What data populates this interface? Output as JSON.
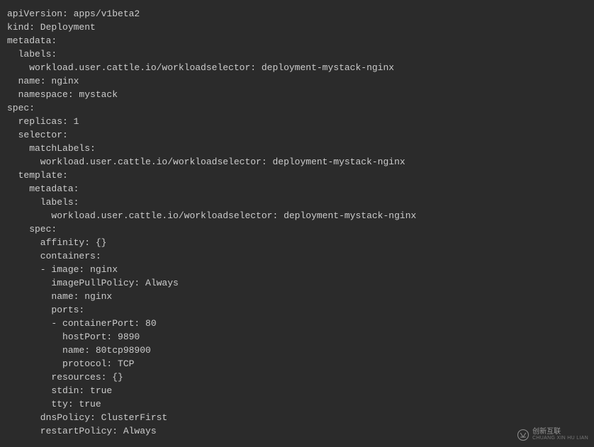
{
  "yaml": {
    "lines": [
      "apiVersion: apps/v1beta2",
      "kind: Deployment",
      "metadata:",
      "  labels:",
      "    workload.user.cattle.io/workloadselector: deployment-mystack-nginx",
      "  name: nginx",
      "  namespace: mystack",
      "spec:",
      "  replicas: 1",
      "  selector:",
      "    matchLabels:",
      "      workload.user.cattle.io/workloadselector: deployment-mystack-nginx",
      "  template:",
      "    metadata:",
      "      labels:",
      "        workload.user.cattle.io/workloadselector: deployment-mystack-nginx",
      "    spec:",
      "      affinity: {}",
      "      containers:",
      "      - image: nginx",
      "        imagePullPolicy: Always",
      "        name: nginx",
      "        ports:",
      "        - containerPort: 80",
      "          hostPort: 9890",
      "          name: 80tcp98900",
      "          protocol: TCP",
      "        resources: {}",
      "        stdin: true",
      "        tty: true",
      "      dnsPolicy: ClusterFirst",
      "      restartPolicy: Always"
    ]
  },
  "watermark": {
    "cn": "创新互联",
    "en": "CHUANG XIN HU LIAN"
  }
}
